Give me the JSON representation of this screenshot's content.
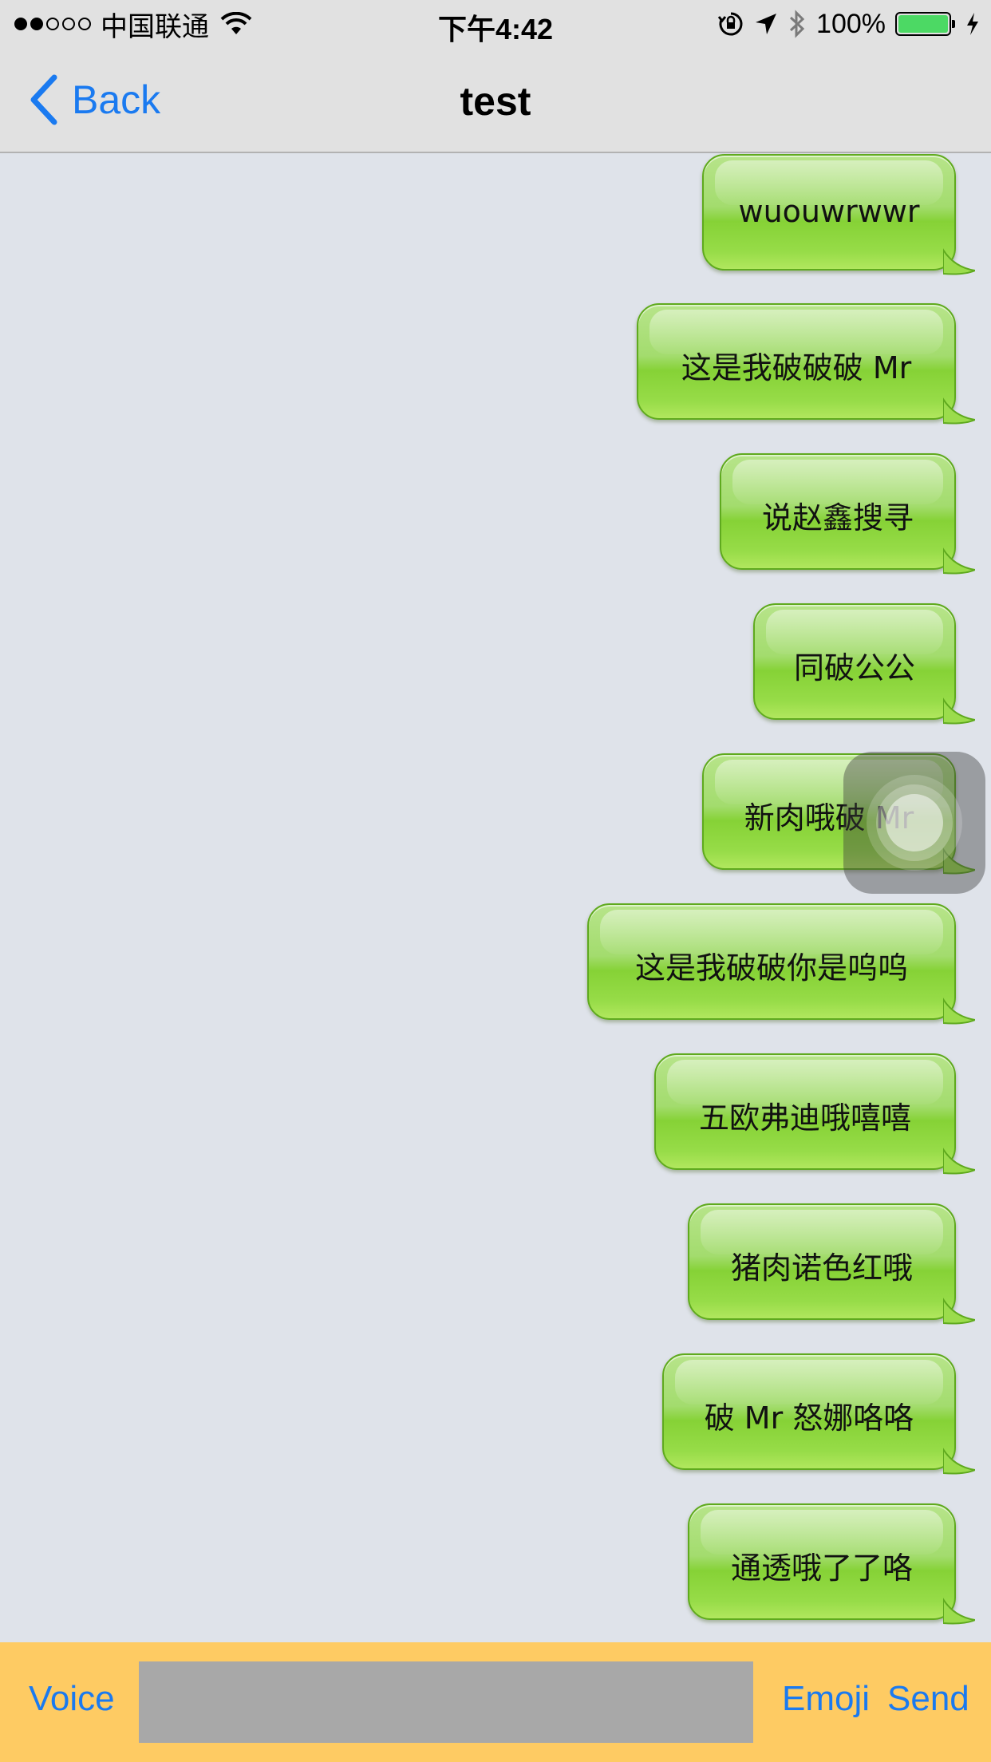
{
  "status_bar": {
    "carrier": "中国联通",
    "signal_strength": 2,
    "signal_max": 5,
    "time": "下午4:42",
    "battery_percent": "100%",
    "battery_color": "#4cd964",
    "icons": [
      "wifi-icon",
      "orientation-lock-icon",
      "location-icon",
      "bluetooth-icon",
      "battery-icon",
      "charging-icon"
    ]
  },
  "nav": {
    "back_label": "Back",
    "title": "test",
    "accent_color": "#1a7af0"
  },
  "messages": [
    {
      "text": "wuouwrwwr"
    },
    {
      "text": "这是我破破破 Mr"
    },
    {
      "text": "说赵鑫搜寻"
    },
    {
      "text": "同破公公"
    },
    {
      "text": "新肉哦破 Mr"
    },
    {
      "text": "这是我破破你是呜呜"
    },
    {
      "text": "五欧弗迪哦嘻嘻"
    },
    {
      "text": "猪肉诺色红哦"
    },
    {
      "text": "破 Mr 怒娜咯咯"
    },
    {
      "text": "通透哦了了咯"
    }
  ],
  "input_bar": {
    "voice_label": "Voice",
    "input_value": "",
    "input_placeholder": "",
    "emoji_label": "Emoji",
    "send_label": "Send",
    "background_color": "#fecb63"
  }
}
